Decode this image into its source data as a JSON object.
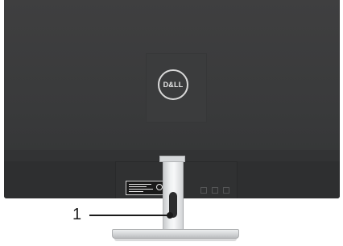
{
  "figure": {
    "brand_logo_text": "D&LL",
    "callouts": [
      {
        "number": "1",
        "target": "cable-management-slot"
      }
    ]
  },
  "colors": {
    "monitor_body": "#3a3b3c",
    "stand": "#e4e6e8",
    "callout": "#1a1a1a",
    "background": "#ffffff"
  },
  "icons": [
    "dell-logo-icon",
    "regulatory-label-icon",
    "cable-hole-icon"
  ]
}
